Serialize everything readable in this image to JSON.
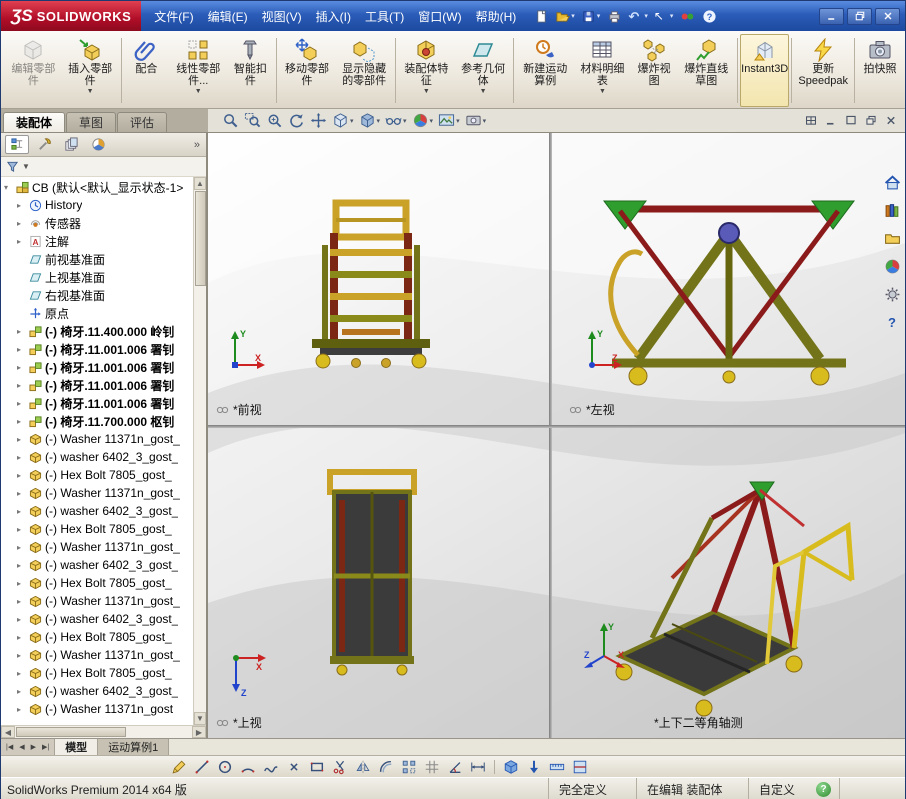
{
  "titlebar": {
    "logo": "ƷS",
    "brand": "SOLIDWORKS",
    "menus": [
      "文件(F)",
      "编辑(E)",
      "视图(V)",
      "插入(I)",
      "工具(T)",
      "窗口(W)",
      "帮助(H)"
    ],
    "quick_icons": [
      {
        "icon": "new"
      },
      {
        "icon": "open",
        "dropdown": true
      },
      {
        "icon": "save",
        "dropdown": true
      },
      {
        "icon": "print"
      },
      {
        "icon": "undo",
        "dropdown": true
      },
      {
        "icon": "select-arrow",
        "dropdown": true
      },
      {
        "icon": "record-toggle"
      },
      {
        "icon": "help-circle"
      }
    ],
    "window_controls": [
      {
        "icon": "win-minimize"
      },
      {
        "icon": "win-restore"
      },
      {
        "icon": "win-close"
      }
    ]
  },
  "ribbon": {
    "buttons": [
      {
        "label": "编辑零部件",
        "icon": "edit-component",
        "disabled": true
      },
      {
        "label": "插入零部件",
        "icon": "insert-component",
        "dropdown": true,
        "sep_after": true
      },
      {
        "label": "配合",
        "icon": "mate"
      },
      {
        "label": "线性零部件...",
        "icon": "linear-pattern",
        "dropdown": true
      },
      {
        "label": "智能扣件",
        "icon": "smart-fasteners",
        "sep_after": true
      },
      {
        "label": "移动零部件",
        "icon": "move-component"
      },
      {
        "label": "显示隐藏的零部件",
        "icon": "show-hidden",
        "sep_after": true
      },
      {
        "label": "装配体特征",
        "icon": "assembly-features",
        "dropdown": true
      },
      {
        "label": "参考几何体",
        "icon": "reference-geometry",
        "dropdown": true,
        "sep_after": true
      },
      {
        "label": "新建运动算例",
        "icon": "motion-study"
      },
      {
        "label": "材料明细表",
        "icon": "bom",
        "dropdown": true
      },
      {
        "label": "爆炸视图",
        "icon": "exploded-view"
      },
      {
        "label": "爆炸直线草图",
        "icon": "explode-line",
        "sep_after": true
      },
      {
        "label": "Instant3D",
        "icon": "instant3d",
        "pressed": true,
        "sep_after": true
      },
      {
        "label": "更新Speedpak",
        "icon": "speedpak",
        "sep_after": true
      },
      {
        "label": "拍快照",
        "icon": "snapshot"
      }
    ]
  },
  "command_tabs": [
    {
      "label": "装配体",
      "active": true
    },
    {
      "label": "草图"
    },
    {
      "label": "评估"
    }
  ],
  "hud_toolbar": [
    {
      "icon": "zoom-fit"
    },
    {
      "icon": "zoom-area"
    },
    {
      "icon": "zoom-in-out"
    },
    {
      "icon": "rotate-view"
    },
    {
      "icon": "pan"
    },
    {
      "icon": "view-orientation",
      "dropdown": true
    },
    {
      "icon": "display-style",
      "dropdown": true
    },
    {
      "icon": "hide-show-items",
      "dropdown": true
    },
    {
      "icon": "edit-appearance",
      "dropdown": true
    },
    {
      "icon": "apply-scene",
      "dropdown": true
    },
    {
      "icon": "view-settings",
      "dropdown": true
    }
  ],
  "doc_controls": [
    {
      "icon": "quad-view"
    },
    {
      "icon": "doc-minimize"
    },
    {
      "icon": "doc-maximize"
    },
    {
      "icon": "doc-restore"
    },
    {
      "icon": "doc-close"
    }
  ],
  "left_panel": {
    "tabs": [
      {
        "icon": "featuremanager",
        "active": true
      },
      {
        "icon": "propertymanager"
      },
      {
        "icon": "configurationmanager"
      },
      {
        "icon": "displaymanager"
      }
    ],
    "overflow": "»",
    "filter_caret": "▼",
    "tree": {
      "root": "CB (默认<默认_显示状态-1>",
      "items": [
        {
          "label": "History",
          "icon": "history"
        },
        {
          "label": "传感器",
          "icon": "sensors"
        },
        {
          "label": "注解",
          "icon": "annotations"
        },
        {
          "label": "前视基准面",
          "icon": "plane",
          "noarrow": true
        },
        {
          "label": "上视基准面",
          "icon": "plane",
          "noarrow": true
        },
        {
          "label": "右视基准面",
          "icon": "plane",
          "noarrow": true
        },
        {
          "label": "原点",
          "icon": "origin",
          "noarrow": true
        },
        {
          "label": "(-) 椅牙.11.400.000 岭钊",
          "icon": "subassembly",
          "bold": true
        },
        {
          "label": "(-) 椅牙.11.001.006 署钊",
          "icon": "subassembly",
          "bold": true
        },
        {
          "label": "(-) 椅牙.11.001.006 署钊",
          "icon": "subassembly",
          "bold": true
        },
        {
          "label": "(-) 椅牙.11.001.006 署钊",
          "icon": "subassembly",
          "bold": true
        },
        {
          "label": "(-) 椅牙.11.001.006 署钊",
          "icon": "subassembly",
          "bold": true
        },
        {
          "label": "(-) 椅牙.11.700.000 枢钊",
          "icon": "subassembly",
          "bold": true
        },
        {
          "label": "(-) Washer 11371n_gost_",
          "icon": "part"
        },
        {
          "label": "(-) washer 6402_3_gost_",
          "icon": "part"
        },
        {
          "label": "(-) Hex Bolt 7805_gost_",
          "icon": "part"
        },
        {
          "label": "(-) Washer 11371n_gost_",
          "icon": "part"
        },
        {
          "label": "(-) washer 6402_3_gost_",
          "icon": "part"
        },
        {
          "label": "(-) Hex Bolt 7805_gost_",
          "icon": "part"
        },
        {
          "label": "(-) Washer 11371n_gost_",
          "icon": "part"
        },
        {
          "label": "(-) washer 6402_3_gost_",
          "icon": "part"
        },
        {
          "label": "(-) Hex Bolt 7805_gost_",
          "icon": "part"
        },
        {
          "label": "(-) Washer 11371n_gost_",
          "icon": "part"
        },
        {
          "label": "(-) washer 6402_3_gost_",
          "icon": "part"
        },
        {
          "label": "(-) Hex Bolt 7805_gost_",
          "icon": "part"
        },
        {
          "label": "(-) Washer 11371n_gost_",
          "icon": "part"
        },
        {
          "label": "(-) Hex Bolt 7805_gost_",
          "icon": "part"
        },
        {
          "label": "(-) washer 6402_3_gost_",
          "icon": "part"
        },
        {
          "label": "(-) Washer 11371n_gost",
          "icon": "part"
        }
      ]
    }
  },
  "viewports": {
    "front": {
      "label": "*前视"
    },
    "left": {
      "label": "*左视"
    },
    "top": {
      "label": "*上视"
    },
    "iso": {
      "label": "*上下二等角轴测"
    }
  },
  "triad": {
    "x": "X",
    "y": "Y",
    "z": "Z"
  },
  "task_pane": [
    {
      "icon": "home"
    },
    {
      "icon": "design-library"
    },
    {
      "icon": "file-explorer"
    },
    {
      "icon": "appearances"
    },
    {
      "icon": "custom-properties"
    },
    {
      "icon": "help"
    }
  ],
  "model_tabs": {
    "nav": [
      "|◀",
      "◀",
      "▶",
      "▶|"
    ],
    "tabs": [
      {
        "label": "模型",
        "active": true
      },
      {
        "label": "运动算例1"
      }
    ]
  },
  "sketch_toolbar": [
    {
      "icon": "sketch"
    },
    {
      "icon": "line"
    },
    {
      "icon": "circle"
    },
    {
      "icon": "arc"
    },
    {
      "icon": "spline"
    },
    {
      "icon": "point"
    },
    {
      "icon": "rectangle"
    },
    {
      "icon": "trim"
    },
    {
      "icon": "mirror"
    },
    {
      "icon": "offset"
    },
    {
      "icon": "sketch-pattern"
    },
    {
      "icon": "grid"
    },
    {
      "icon": "angle"
    },
    {
      "icon": "smart-dimension",
      "sep_after": true
    },
    {
      "icon": "view-cube"
    },
    {
      "icon": "down-arrow"
    },
    {
      "icon": "measure"
    },
    {
      "icon": "section-box"
    }
  ],
  "statusbar": {
    "left": "SolidWorks Premium 2014 x64 版",
    "define_state": "完全定义",
    "edit_state": "在编辑 装配体",
    "custom": "自定义",
    "help_badge": "?"
  },
  "colors": {
    "titlebar_blue": "#2b5cb8",
    "logo_red": "#b00e28",
    "frame_yellow": "#c9a227",
    "frame_olive": "#73731a",
    "frame_darkred": "#8b1a1a",
    "bracket_green": "#2f9e2f"
  }
}
